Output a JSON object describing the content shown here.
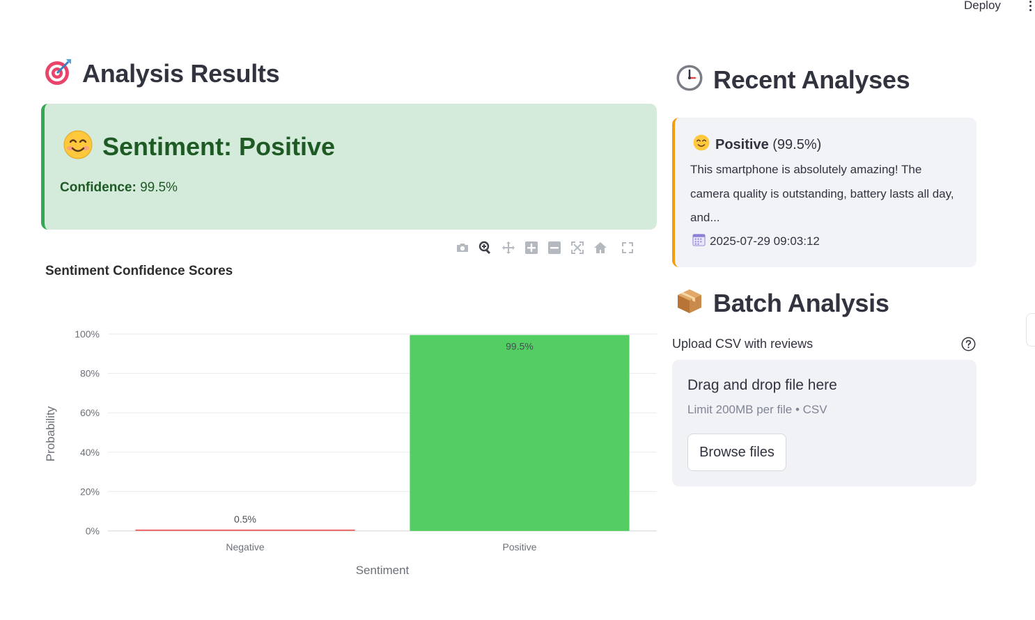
{
  "topbar": {
    "deploy_label": "Deploy"
  },
  "results": {
    "title": "Analysis Results",
    "title_icon": "target-icon",
    "sentiment_text": "Sentiment: Positive",
    "sentiment_icon": "smiling-face-icon",
    "confidence_label": "Confidence:",
    "confidence_value": "99.5%",
    "card_color": "#d4eada",
    "accent_color": "#34a853"
  },
  "chart_toolbar": [
    "camera-icon",
    "zoom-icon",
    "pan-icon",
    "zoom-in-icon",
    "zoom-out-icon",
    "autoscale-icon",
    "reset-axes-icon",
    "fullscreen-icon"
  ],
  "chart_title": "Sentiment Confidence Scores",
  "chart_data": {
    "type": "bar",
    "categories": [
      "Negative",
      "Positive"
    ],
    "values": [
      0.5,
      99.5
    ],
    "data_labels": [
      "0.5%",
      "99.5%"
    ],
    "colors": [
      "#ef6b6b",
      "#52ce62"
    ],
    "xlabel": "Sentiment",
    "ylabel": "Probability",
    "ylim": [
      0,
      100
    ],
    "yticks": [
      "0%",
      "20%",
      "40%",
      "60%",
      "80%",
      "100%"
    ],
    "grid": true
  },
  "recent": {
    "title": "Recent Analyses",
    "title_icon": "clock-icon",
    "item": {
      "icon": "smiling-face-icon",
      "label": "Positive",
      "score": "(99.5%)",
      "text": "This smartphone is absolutely amazing! The camera quality is outstanding, battery lasts all day, and...",
      "date_icon": "calendar-icon",
      "date": "2025-07-29 09:03:12",
      "accent_color": "#f39c12"
    }
  },
  "batch": {
    "title": "Batch Analysis",
    "title_icon": "package-icon",
    "upload_label": "Upload CSV with reviews",
    "dropzone_title": "Drag and drop file here",
    "dropzone_limit": "Limit 200MB per file • CSV",
    "browse_label": "Browse files"
  }
}
